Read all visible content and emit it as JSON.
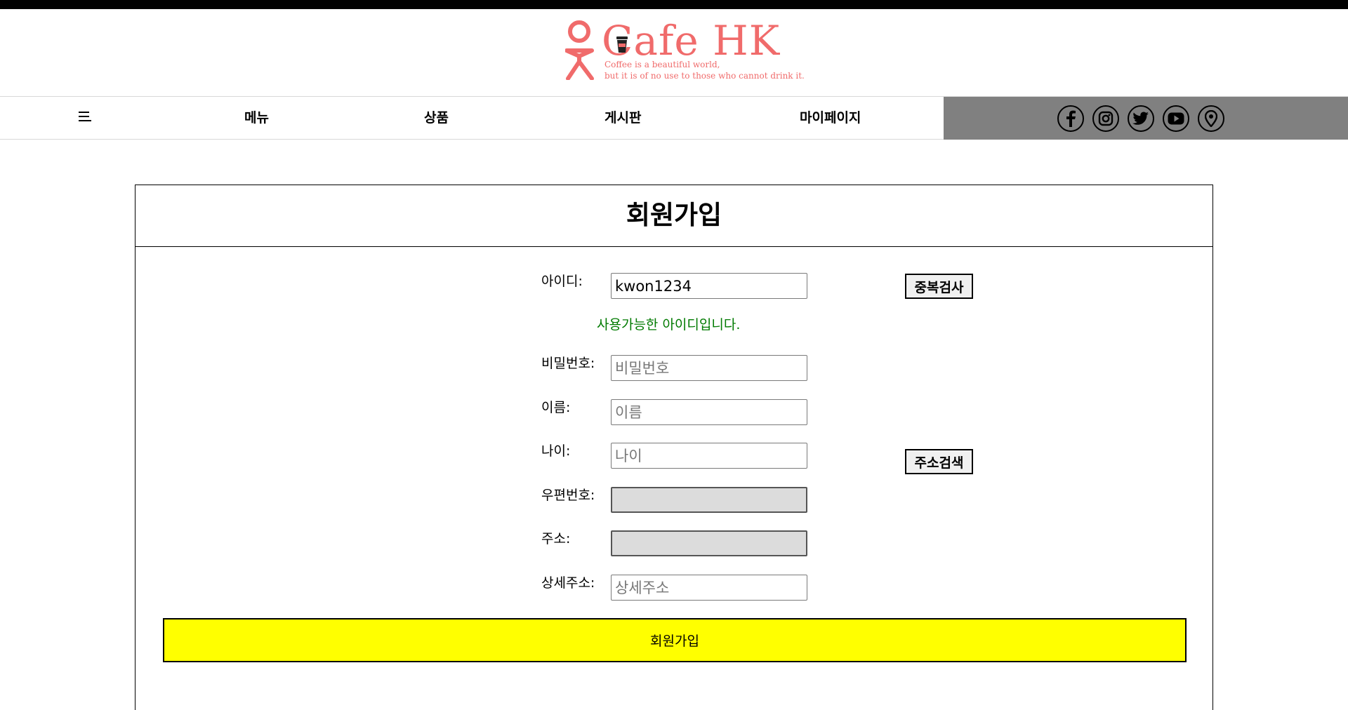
{
  "brand": {
    "name": "Cafe HK",
    "tagline_line1": "Coffee is a beautiful world,",
    "tagline_line2": "but it is of no use to those who cannot drink it.",
    "accent_color": "#f06b6b"
  },
  "nav": {
    "menu_icon": "hamburger-icon",
    "items": [
      "메뉴",
      "상품",
      "게시판",
      "마이페이지"
    ],
    "social_icons": [
      "facebook-icon",
      "instagram-icon",
      "twitter-icon",
      "youtube-icon",
      "location-pin-icon"
    ]
  },
  "form": {
    "title": "회원가입",
    "id_label": "아이디:",
    "id_value": "kwon1234",
    "dup_check_label": "중복검사",
    "id_ok_message": "사용가능한 아이디입니다.",
    "password_label": "비밀번호:",
    "password_placeholder": "비밀번호",
    "name_label": "이름:",
    "name_placeholder": "이름",
    "age_label": "나이:",
    "age_placeholder": "나이",
    "address_search_label": "주소검색",
    "zipcode_label": "우편번호:",
    "address_label": "주소:",
    "detail_address_label": "상세주소:",
    "detail_address_placeholder": "상세주소",
    "submit_label": "회원가입",
    "submit_color": "#ffff00",
    "ok_color": "#007a00"
  }
}
